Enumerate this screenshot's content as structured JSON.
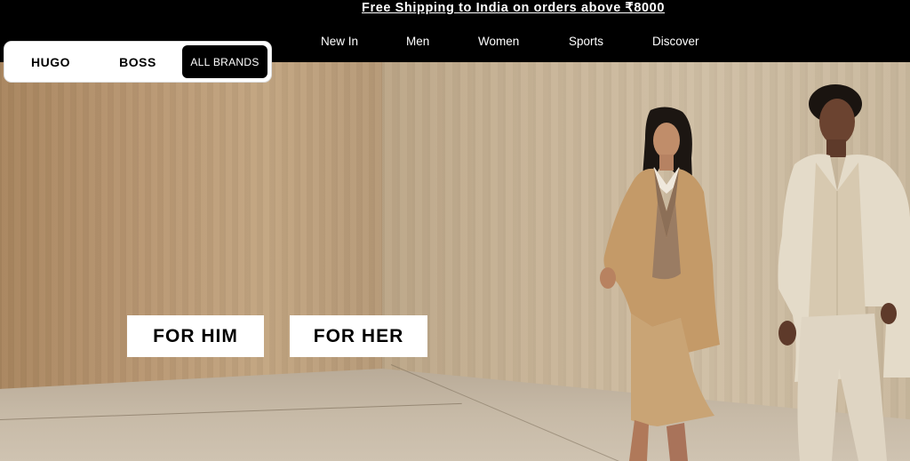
{
  "promo": {
    "text": "Free Shipping to India on orders above ₹8000"
  },
  "nav": {
    "items": [
      "New In",
      "Men",
      "Women",
      "Sports",
      "Discover"
    ]
  },
  "brand_switch": {
    "hugo": "HUGO",
    "boss": "BOSS",
    "all": "ALL BRANDS"
  },
  "hero": {
    "for_him": "FOR HIM",
    "for_her": "FOR HER"
  }
}
